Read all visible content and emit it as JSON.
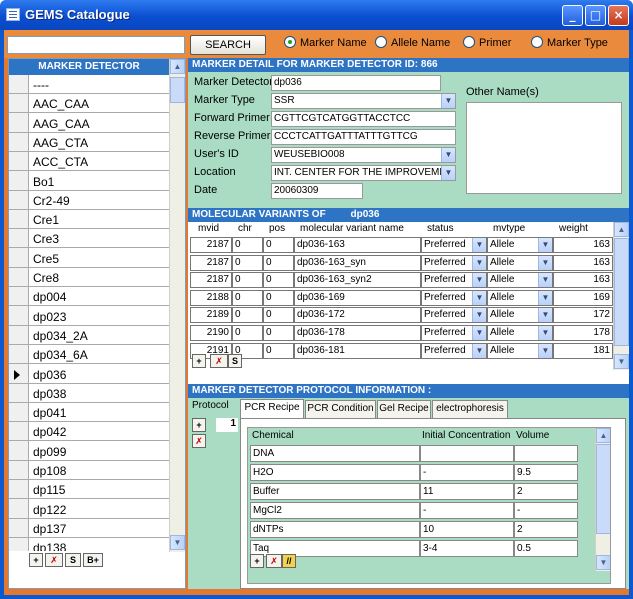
{
  "window": {
    "title": "GEMS Catalogue",
    "minimize": "_",
    "maximize": "□",
    "close": "×"
  },
  "search": {
    "value": "",
    "button": "SEARCH",
    "options": [
      {
        "label": "Marker Name",
        "selected": true
      },
      {
        "label": "Allele Name",
        "selected": false
      },
      {
        "label": "Primer",
        "selected": false
      },
      {
        "label": "Marker Type",
        "selected": false
      }
    ]
  },
  "left": {
    "header": "MARKER DETECTOR",
    "items": [
      "----",
      "AAC_CAA",
      "AAG_CAA",
      "AAG_CTA",
      "ACC_CTA",
      "Bo1",
      "Cr2-49",
      "Cre1",
      "Cre3",
      "Cre5",
      "Cre8",
      "dp004",
      "dp023",
      "dp034_2A",
      "dp034_6A",
      "dp036",
      "dp038",
      "dp041",
      "dp042",
      "dp099",
      "dp108",
      "dp115",
      "dp122",
      "dp137",
      "dp138"
    ],
    "current_index": 15,
    "buttons": [
      "+",
      "✗",
      "S",
      "B+"
    ]
  },
  "detail": {
    "header": "MARKER DETAIL FOR MARKER DETECTOR ID:  866",
    "fields": [
      {
        "label": "Marker Detector",
        "value": "dp036"
      },
      {
        "label": "Marker Type",
        "value": "SSR"
      },
      {
        "label": "Forward Primer",
        "value": "CGTTCGTCATGGTTACCTCC"
      },
      {
        "label": "Reverse Primer",
        "value": "CCCTCATTGATTTATTTGTTCG"
      },
      {
        "label": "User's ID",
        "value": "WEUSEBIO008"
      },
      {
        "label": "Location",
        "value": "INT. CENTER FOR THE IMPROVEME"
      },
      {
        "label": "Date",
        "value": "20060309"
      }
    ],
    "other_names_label": "Other Name(s)"
  },
  "variants": {
    "header_prefix": "MOLECULAR VARIANTS OF",
    "header_marker": "dp036",
    "columns": [
      "mvid",
      "chr",
      "pos",
      "molecular variant name",
      "status",
      "mvtype",
      "weight"
    ],
    "rows": [
      [
        "2187",
        "0",
        "0",
        "dp036-163",
        "Preferred",
        "Allele",
        "163"
      ],
      [
        "2187",
        "0",
        "0",
        "dp036-163_syn",
        "Preferred",
        "Allele",
        "163"
      ],
      [
        "2187",
        "0",
        "0",
        "dp036-163_syn2",
        "Preferred",
        "Allele",
        "163"
      ],
      [
        "2188",
        "0",
        "0",
        "dp036-169",
        "Preferred",
        "Allele",
        "169"
      ],
      [
        "2189",
        "0",
        "0",
        "dp036-172",
        "Preferred",
        "Allele",
        "172"
      ],
      [
        "2190",
        "0",
        "0",
        "dp036-178",
        "Preferred",
        "Allele",
        "178"
      ],
      [
        "2191",
        "0",
        "0",
        "dp036-181",
        "Preferred",
        "Allele",
        "181"
      ]
    ],
    "buttons": [
      "+",
      "✗",
      "S"
    ]
  },
  "protocol": {
    "header": "MARKER DETECTOR PROTOCOL INFORMATION :",
    "label": "Protocol",
    "number": "1",
    "tabs": [
      "PCR Recipe",
      "PCR Condition",
      "Gel Recipe",
      "electrophoresis"
    ],
    "active_tab": 0,
    "chem_columns": [
      "Chemical",
      "Initial Concentration",
      "Volume"
    ],
    "chem_rows": [
      [
        "DNA",
        "",
        ""
      ],
      [
        "H2O",
        "-",
        "9.5"
      ],
      [
        "Buffer",
        "11",
        "2"
      ],
      [
        "MgCl2",
        "-",
        "-"
      ],
      [
        "dNTPs",
        "10",
        "2"
      ],
      [
        "Taq",
        "3-4",
        "0.5"
      ]
    ],
    "buttons": [
      "+",
      "✗",
      "//"
    ]
  }
}
